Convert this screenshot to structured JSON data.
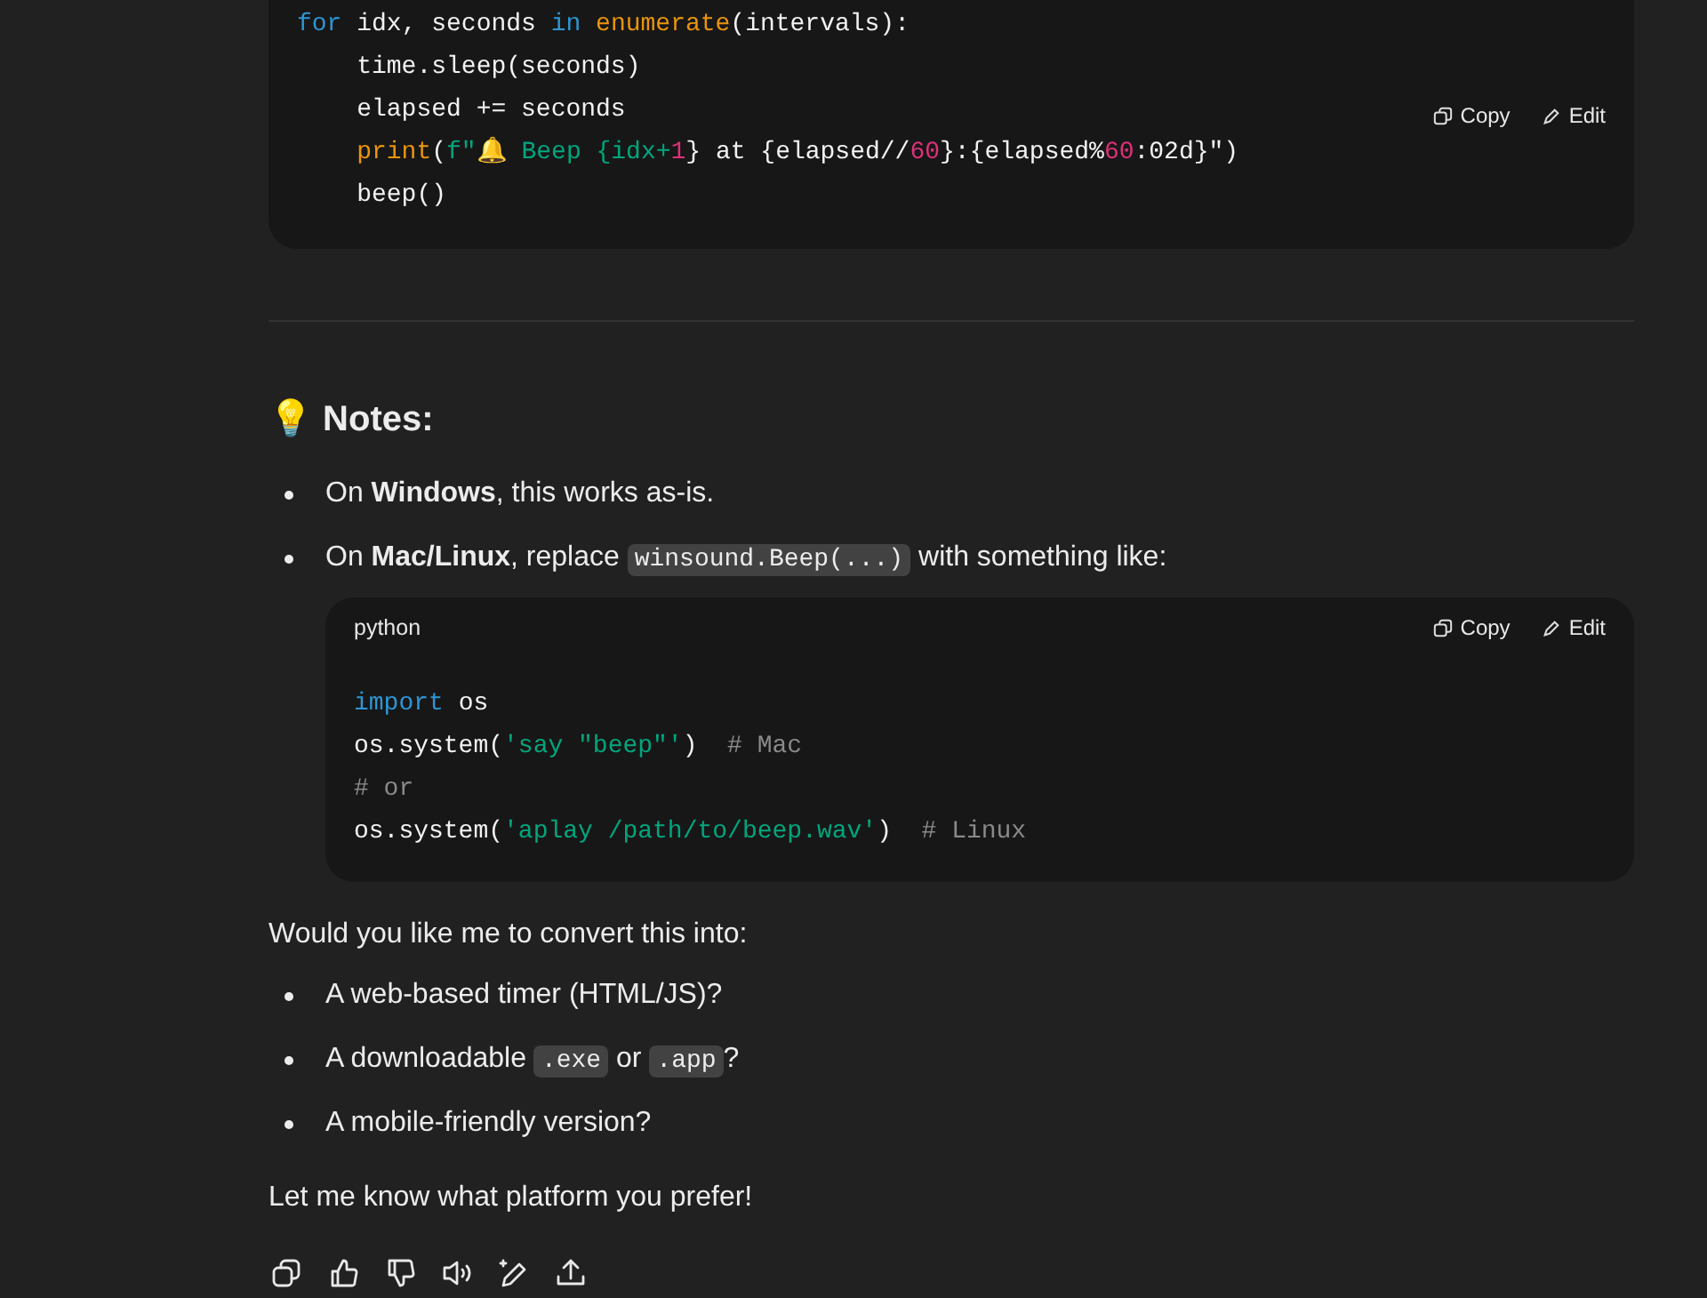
{
  "top_code_block": {
    "actions": [
      {
        "kind": "copy",
        "label": "Copy"
      },
      {
        "kind": "edit",
        "label": "Edit"
      }
    ],
    "lines": [
      {
        "tokens": [
          {
            "kind": "kw",
            "text": "for"
          },
          {
            "kind": "plain",
            "text": " idx, seconds "
          },
          {
            "kind": "kw",
            "text": "in"
          },
          {
            "kind": "fn",
            "text": " enumerate"
          },
          {
            "kind": "plain",
            "text": "(intervals):"
          }
        ]
      },
      {
        "tokens": [
          {
            "kind": "plain",
            "text": "    time.sleep(seconds)"
          }
        ]
      },
      {
        "tokens": [
          {
            "kind": "plain",
            "text": "    elapsed += seconds"
          }
        ]
      },
      {
        "tokens": [
          {
            "kind": "fn",
            "text": "    print"
          },
          {
            "kind": "plain",
            "text": "("
          },
          {
            "kind": "str",
            "text": "f\"🔔 Beep "
          },
          {
            "kind": "str",
            "text": "{idx+"
          },
          {
            "kind": "num",
            "text": "1"
          },
          {
            "kind": "plain",
            "text": "} at {elapsed//"
          },
          {
            "kind": "num",
            "text": "60"
          },
          {
            "kind": "plain",
            "text": "}:{elapsed%"
          },
          {
            "kind": "num",
            "text": "60"
          },
          {
            "kind": "plain",
            "text": ":02d}\")"
          }
        ]
      },
      {
        "tokens": [
          {
            "kind": "plain",
            "text": "    beep()"
          }
        ]
      }
    ]
  },
  "notes_heading": "💡 Notes:",
  "notes": [
    [
      {
        "kind": "text",
        "text": "On **Windows**, this works as-is."
      }
    ],
    [
      {
        "kind": "text",
        "text": "On **Mac/Linux**, replace "
      },
      {
        "kind": "code",
        "text": "winsound.Beep(...)"
      },
      {
        "kind": "text",
        "text": " with something like:"
      }
    ]
  ],
  "code_block": {
    "language": "python",
    "actions": [
      {
        "kind": "copy",
        "label": "Copy"
      },
      {
        "kind": "edit",
        "label": "Edit"
      }
    ],
    "lines": [
      {
        "tokens": [
          {
            "kind": "kw",
            "text": "import"
          },
          {
            "kind": "plain",
            "text": " os"
          }
        ]
      },
      {
        "tokens": [
          {
            "kind": "plain",
            "text": "os.system("
          },
          {
            "kind": "str",
            "text": "'say \"beep\"'"
          },
          {
            "kind": "plain",
            "text": ")"
          },
          {
            "kind": "comment",
            "text": "  # Mac"
          }
        ]
      },
      {
        "tokens": [
          {
            "kind": "comment",
            "text": "# or"
          }
        ]
      },
      {
        "tokens": [
          {
            "kind": "plain",
            "text": "os.system("
          },
          {
            "kind": "str",
            "text": "'aplay /path/to/beep.wav'"
          },
          {
            "kind": "plain",
            "text": ")"
          },
          {
            "kind": "comment",
            "text": "  # Linux"
          }
        ]
      }
    ]
  },
  "question": "Would you like me to convert this into:",
  "options": [
    [
      {
        "kind": "text",
        "text": "A web-based timer (HTML/JS)?"
      }
    ],
    [
      {
        "kind": "text",
        "text": "A downloadable "
      },
      {
        "kind": "code",
        "text": ".exe"
      },
      {
        "kind": "text",
        "text": " or "
      },
      {
        "kind": "code",
        "text": ".app"
      },
      {
        "kind": "text",
        "text": "?"
      }
    ],
    [
      {
        "kind": "text",
        "text": "A mobile-friendly version?"
      }
    ]
  ],
  "closing": "Let me know what platform you prefer!",
  "toolbar": [
    {
      "kind": "copy"
    },
    {
      "kind": "thumbs-up"
    },
    {
      "kind": "thumbs-down"
    },
    {
      "kind": "speaker"
    },
    {
      "kind": "edit"
    },
    {
      "kind": "share"
    }
  ]
}
